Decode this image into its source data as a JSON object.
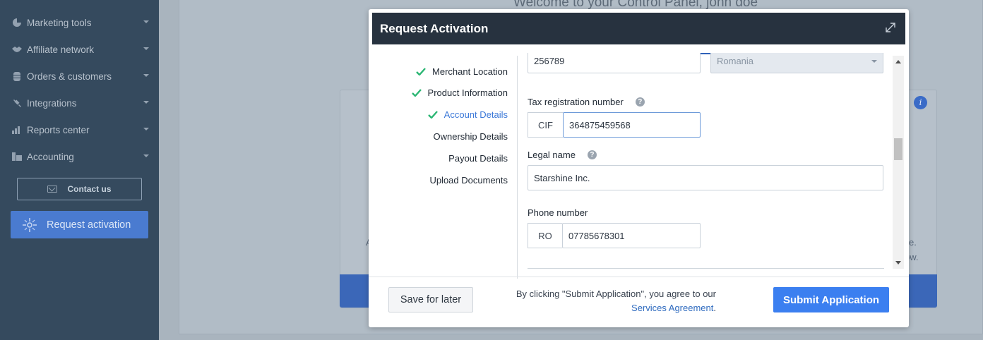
{
  "sidebar": {
    "items": [
      {
        "label": "Marketing tools",
        "icon": "pie-chart-icon"
      },
      {
        "label": "Affiliate network",
        "icon": "handshake-icon"
      },
      {
        "label": "Orders & customers",
        "icon": "database-icon"
      },
      {
        "label": "Integrations",
        "icon": "plug-icon"
      },
      {
        "label": "Reports center",
        "icon": "bar-chart-icon"
      },
      {
        "label": "Accounting",
        "icon": "accounting-icon"
      }
    ],
    "contact_label": "Contact us",
    "request_label": "Request activation"
  },
  "background": {
    "welcome": "Welcome to your Control Panel, john doe",
    "fragment_left": "A",
    "fragment_right_1": "e.",
    "fragment_right_2": "ow."
  },
  "modal": {
    "title": "Request Activation",
    "steps": [
      {
        "label": "Merchant Location",
        "done": true
      },
      {
        "label": "Product Information",
        "done": true
      },
      {
        "label": "Account Details",
        "done": true,
        "active": true
      },
      {
        "label": "Ownership Details",
        "done": false
      },
      {
        "label": "Payout Details",
        "done": false
      },
      {
        "label": "Upload Documents",
        "done": false
      }
    ],
    "form": {
      "postal_value": "256789",
      "country_value": "Romania",
      "tax_label": "Tax registration number",
      "tax_prefix": "CIF",
      "tax_value": "364875459568",
      "legal_label": "Legal name",
      "legal_value": "Starshine Inc.",
      "phone_label": "Phone number",
      "phone_prefix": "RO",
      "phone_value": "07785678301"
    },
    "footer": {
      "save_label": "Save for later",
      "agree_text": "By clicking \"Submit Application\", you agree to our",
      "agree_link": "Services Agreement",
      "agree_end": ".",
      "submit_label": "Submit Application"
    }
  },
  "colors": {
    "sidebar_bg": "#354a5e",
    "modal_header": "#27323f",
    "accent": "#3b7ff0",
    "check_green": "#2bb673",
    "active_step": "#3b78d8"
  }
}
